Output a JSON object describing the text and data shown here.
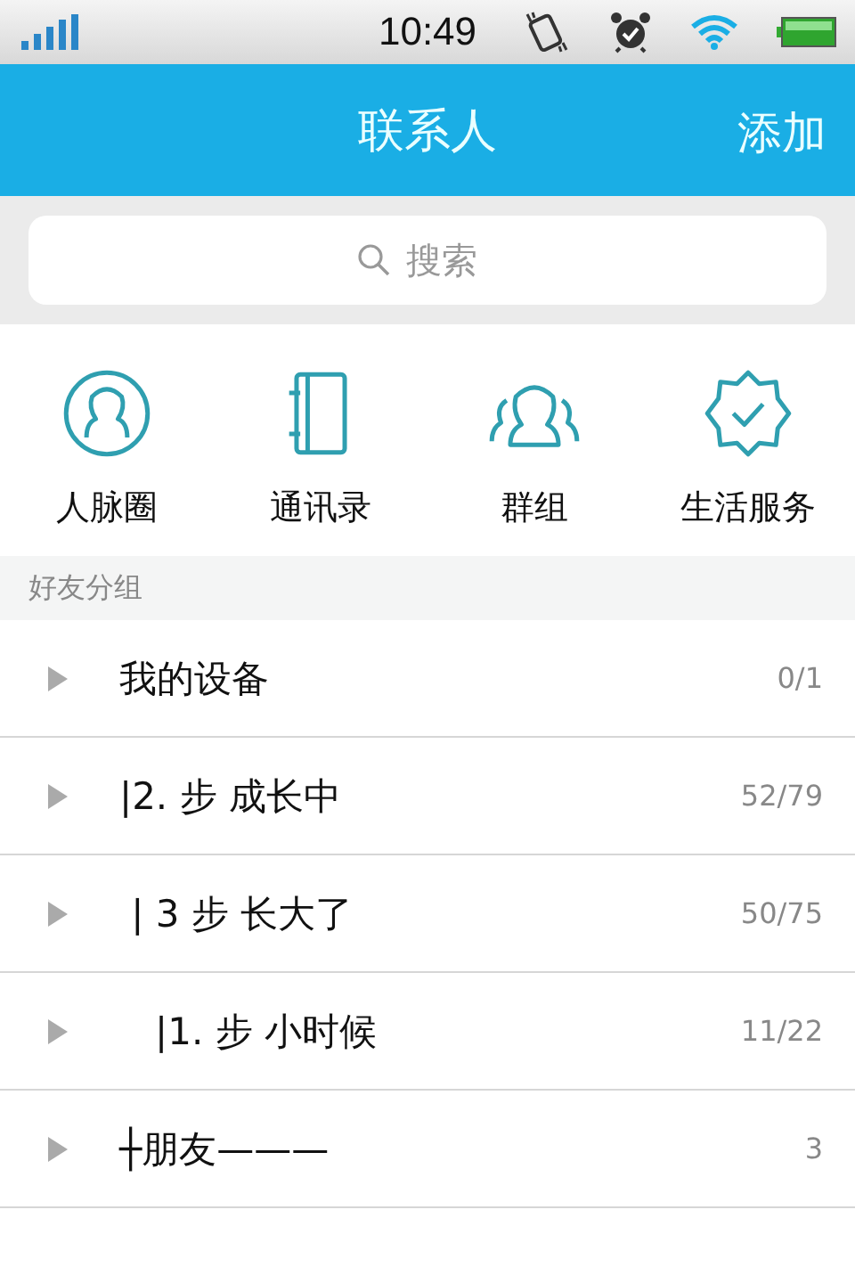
{
  "status_bar": {
    "time": "10:49"
  },
  "header": {
    "title": "联系人",
    "action": "添加"
  },
  "search": {
    "placeholder": "搜索"
  },
  "shortcuts": [
    {
      "kind": "circle",
      "label": "人脉圈"
    },
    {
      "kind": "book",
      "label": "通讯录"
    },
    {
      "kind": "group",
      "label": "群组"
    },
    {
      "kind": "badge",
      "label": "生活服务"
    }
  ],
  "section": {
    "title": "好友分组"
  },
  "groups": [
    {
      "name": "我的设备",
      "count": "0/1",
      "expanded": false
    },
    {
      "name": "|2. 步 成长中",
      "count": "52/79",
      "expanded": false
    },
    {
      "name": " | 3 步 长大了",
      "count": "50/75",
      "expanded": false
    },
    {
      "name": "   |1. 步 小时候",
      "count": "11/22",
      "expanded": false
    },
    {
      "name": "┼朋友———",
      "count": "3",
      "expanded": false
    }
  ]
}
